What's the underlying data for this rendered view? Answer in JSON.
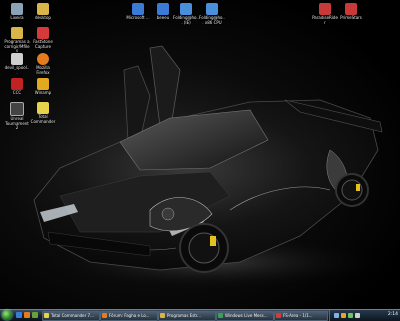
{
  "desktop_icons": [
    {
      "label": "Lixeira",
      "name": "recycle-bin-icon",
      "color": "#8aa3b7"
    },
    {
      "label": "desktop",
      "name": "folder-icon",
      "color": "#d9b44a"
    },
    {
      "label": "Programas a corrigir/Mfiles",
      "name": "folder-icon",
      "color": "#d9b44a"
    },
    {
      "label": "FastStone Capture",
      "name": "capture-app-icon",
      "color": "#d43a3a"
    },
    {
      "label": "devil_spool...",
      "name": "document-icon",
      "color": "#cfcfcf"
    },
    {
      "label": "Mozilla Firefox",
      "name": "firefox-icon",
      "color": "#e37b1f"
    },
    {
      "label": "CCC",
      "name": "ati-icon",
      "color": "#c22222"
    },
    {
      "label": "Winamp",
      "name": "winamp-icon",
      "color": "#e3a81f"
    },
    {
      "label": "Unreal Tournament 2",
      "name": "game-icon",
      "color": "#444444"
    },
    {
      "label": "Total Commander",
      "name": "total-commander-icon",
      "color": "#e8d24a"
    },
    {
      "label": "Microsoft ...",
      "name": "microsoft-app-icon",
      "color": "#3a7bd5"
    },
    {
      "label": "beeeu",
      "name": "app-icon",
      "color": "#3a7bd5"
    },
    {
      "label": "Folding@ho... (IE)",
      "name": "folding-icon",
      "color": "#4a8fd9"
    },
    {
      "label": "Folding@ho... x86 CPU",
      "name": "folding-icon",
      "color": "#4a8fd9"
    },
    {
      "label": "ParadiseRider",
      "name": "game-icon",
      "color": "#c83a3a"
    },
    {
      "label": "PrimeStars",
      "name": "game-icon",
      "color": "#c83a3a"
    }
  ],
  "taskbar": {
    "quicklaunch_colors": [
      "#3a7bd5",
      "#e37b1f",
      "#6a9f3a"
    ],
    "tasks": [
      {
        "label": "Total Commander 7...",
        "color": "#e8d24a"
      },
      {
        "label": "Fórum: Fagha e Lo...",
        "color": "#e37b1f"
      },
      {
        "label": "Programas Estr...",
        "color": "#d9b44a"
      },
      {
        "label": "Windows Live Mess...",
        "color": "#3a9f5a"
      },
      {
        "label": "FS-Area - 1/1...",
        "color": "#d43a3a"
      }
    ],
    "tray_colors": [
      "#7fb3e6",
      "#e3a81f",
      "#6ac46a",
      "#cfcfcf"
    ],
    "clock": "2:14"
  }
}
